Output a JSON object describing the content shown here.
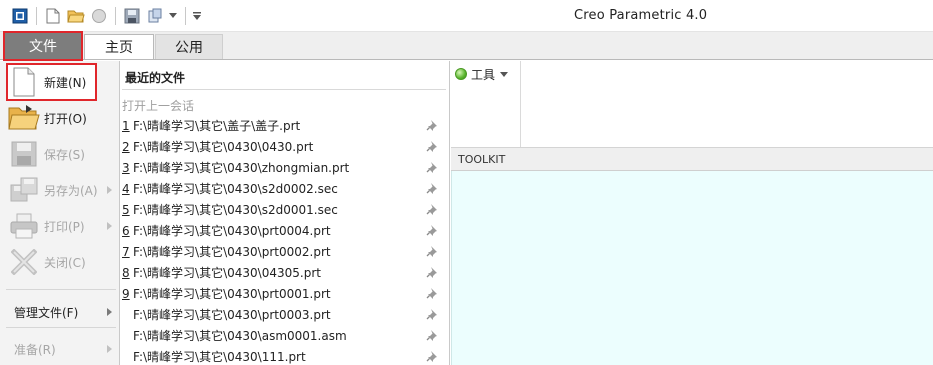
{
  "window": {
    "title": "Creo Parametric 4.0"
  },
  "quick_access": {
    "icons": [
      "app-icon",
      "new-icon",
      "open-icon",
      "regenerate-icon",
      "save-icon",
      "windows-icon",
      "customize-icon"
    ]
  },
  "tabs": [
    {
      "label": "文件"
    },
    {
      "label": "主页"
    },
    {
      "label": "公用"
    }
  ],
  "file_menu": {
    "new": "新建(N)",
    "open": "打开(O)",
    "save": "保存(S)",
    "save_as": "另存为(A)",
    "print": "打印(P)",
    "close": "关闭(C)",
    "manage_files": "管理文件(F)",
    "prepare": "准备(R)"
  },
  "recent": {
    "header": "最近的文件",
    "session_label": "打开上一会话",
    "items": [
      {
        "num": "1",
        "path": " F:\\晴峰学习\\其它\\盖子\\盖子.prt"
      },
      {
        "num": "2",
        "path": " F:\\晴峰学习\\其它\\0430\\0430.prt"
      },
      {
        "num": "3",
        "path": " F:\\晴峰学习\\其它\\0430\\zhongmian.prt"
      },
      {
        "num": "4",
        "path": " F:\\晴峰学习\\其它\\0430\\s2d0002.sec"
      },
      {
        "num": "5",
        "path": " F:\\晴峰学习\\其它\\0430\\s2d0001.sec"
      },
      {
        "num": "6",
        "path": " F:\\晴峰学习\\其它\\0430\\prt0004.prt"
      },
      {
        "num": "7",
        "path": " F:\\晴峰学习\\其它\\0430\\prt0002.prt"
      },
      {
        "num": "8",
        "path": " F:\\晴峰学习\\其它\\0430\\04305.prt"
      },
      {
        "num": "9",
        "path": " F:\\晴峰学习\\其它\\0430\\prt0001.prt"
      },
      {
        "num": "",
        "path": " F:\\晴峰学习\\其它\\0430\\prt0003.prt"
      },
      {
        "num": "",
        "path": " F:\\晴峰学习\\其它\\0430\\asm0001.asm"
      },
      {
        "num": "",
        "path": " F:\\晴峰学习\\其它\\0430\\111.prt"
      }
    ]
  },
  "toolbar": {
    "tools_label": "工具",
    "toolkit_label": "TOOLKIT"
  },
  "colors": {
    "highlight": "#e0262b",
    "file_tab": "#7d7d7d",
    "graphics_bg": "#ecfefe"
  }
}
